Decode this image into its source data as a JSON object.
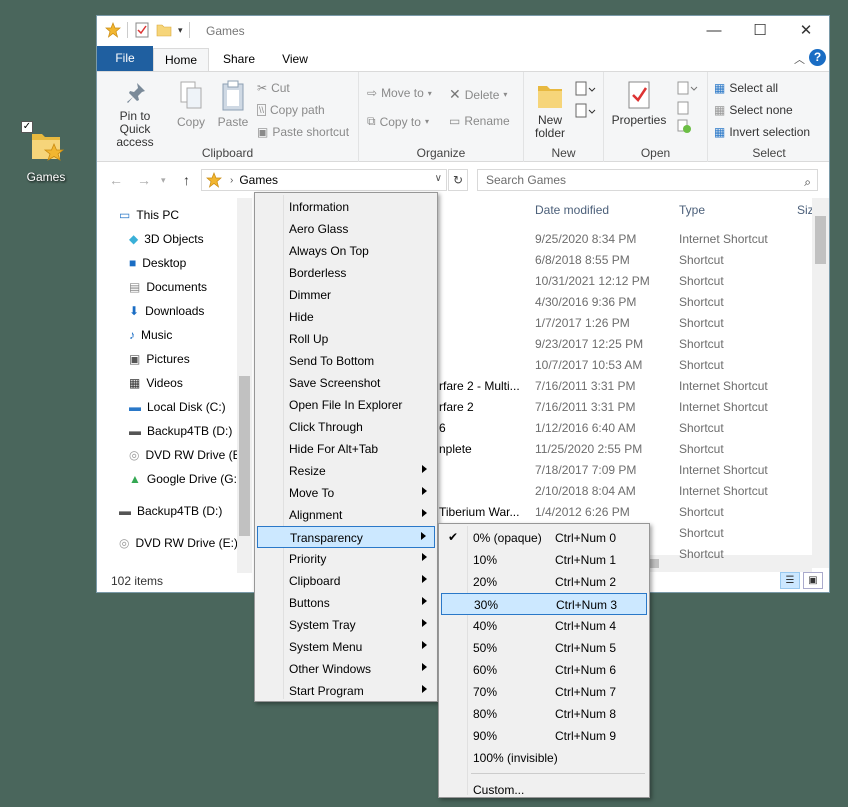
{
  "desktop": {
    "icon_label": "Games"
  },
  "window": {
    "title": "Games",
    "tabs": [
      "File",
      "Home",
      "Share",
      "View"
    ],
    "ribbon": {
      "clipboard": {
        "pin_label": "Pin to Quick\naccess",
        "copy_label": "Copy",
        "paste_label": "Paste",
        "cut_label": "Cut",
        "copy_path_label": "Copy path",
        "paste_shortcut_label": "Paste shortcut",
        "group_label": "Clipboard"
      },
      "organize": {
        "move_to_label": "Move to",
        "copy_to_label": "Copy to",
        "delete_label": "Delete",
        "rename_label": "Rename",
        "group_label": "Organize"
      },
      "new": {
        "new_folder_label": "New\nfolder",
        "group_label": "New"
      },
      "open": {
        "properties_label": "Properties",
        "group_label": "Open"
      },
      "select": {
        "select_all_label": "Select all",
        "select_none_label": "Select none",
        "invert_label": "Invert selection",
        "group_label": "Select"
      }
    },
    "address": {
      "path": "Games",
      "search_placeholder": "Search Games"
    },
    "nav": [
      "This PC",
      "3D Objects",
      "Desktop",
      "Documents",
      "Downloads",
      "Music",
      "Pictures",
      "Videos",
      "Local Disk (C:)",
      "Backup4TB (D:)",
      "DVD RW Drive (E",
      "Google Drive (G:",
      "Backup4TB (D:)",
      "DVD RW Drive (E:)"
    ],
    "columns": {
      "date": "Date modified",
      "type": "Type",
      "size": "Siz"
    },
    "rows": [
      {
        "name": "",
        "date": "9/25/2020 8:34 PM",
        "type": "Internet Shortcut"
      },
      {
        "name": "",
        "date": "6/8/2018 8:55 PM",
        "type": "Shortcut"
      },
      {
        "name": "",
        "date": "10/31/2021 12:12 PM",
        "type": "Shortcut"
      },
      {
        "name": "",
        "date": "4/30/2016 9:36 PM",
        "type": "Shortcut"
      },
      {
        "name": "",
        "date": "1/7/2017 1:26 PM",
        "type": "Shortcut"
      },
      {
        "name": "",
        "date": "9/23/2017 12:25 PM",
        "type": "Shortcut"
      },
      {
        "name": "",
        "date": "10/7/2017 10:53 AM",
        "type": "Shortcut"
      },
      {
        "name": "rfare 2 - Multi...",
        "date": "7/16/2011 3:31 PM",
        "type": "Internet Shortcut"
      },
      {
        "name": "rfare 2",
        "date": "7/16/2011 3:31 PM",
        "type": "Internet Shortcut"
      },
      {
        "name": "6",
        "date": "1/12/2016 6:40 AM",
        "type": "Shortcut"
      },
      {
        "name": "nplete",
        "date": "11/25/2020 2:55 PM",
        "type": "Shortcut"
      },
      {
        "name": "",
        "date": "7/18/2017 7:09 PM",
        "type": "Internet Shortcut"
      },
      {
        "name": "",
        "date": "2/10/2018 8:04 AM",
        "type": "Internet Shortcut"
      },
      {
        "name": "Tiberium War...",
        "date": "1/4/2012 6:26 PM",
        "type": "Shortcut"
      },
      {
        "name": "",
        "date": "",
        "type": "Shortcut"
      },
      {
        "name": "",
        "date": "",
        "type": "Shortcut"
      }
    ],
    "status": {
      "count": "102 items"
    }
  },
  "context_menu": {
    "items": [
      {
        "label": "Information",
        "sub": false
      },
      {
        "label": "Aero Glass",
        "sub": false
      },
      {
        "label": "Always On Top",
        "sub": false
      },
      {
        "label": "Borderless",
        "sub": false
      },
      {
        "label": "Dimmer",
        "sub": false
      },
      {
        "label": "Hide",
        "sub": false
      },
      {
        "label": "Roll Up",
        "sub": false
      },
      {
        "label": "Send To Bottom",
        "sub": false
      },
      {
        "label": "Save Screenshot",
        "sub": false
      },
      {
        "label": "Open File In Explorer",
        "sub": false
      },
      {
        "label": "Click Through",
        "sub": false
      },
      {
        "label": "Hide For Alt+Tab",
        "sub": false
      },
      {
        "label": "Resize",
        "sub": true
      },
      {
        "label": "Move To",
        "sub": true
      },
      {
        "label": "Alignment",
        "sub": true
      },
      {
        "label": "Transparency",
        "sub": true,
        "highlighted": true
      },
      {
        "label": "Priority",
        "sub": true
      },
      {
        "label": "Clipboard",
        "sub": true
      },
      {
        "label": "Buttons",
        "sub": true
      },
      {
        "label": "System Tray",
        "sub": true
      },
      {
        "label": "System Menu",
        "sub": true
      },
      {
        "label": "Other Windows",
        "sub": true
      },
      {
        "label": "Start Program",
        "sub": true
      }
    ]
  },
  "transparency_menu": {
    "items": [
      {
        "label": "0% (opaque)",
        "shortcut": "Ctrl+Num 0",
        "checked": true
      },
      {
        "label": "10%",
        "shortcut": "Ctrl+Num 1"
      },
      {
        "label": "20%",
        "shortcut": "Ctrl+Num 2"
      },
      {
        "label": "30%",
        "shortcut": "Ctrl+Num 3",
        "highlighted": true
      },
      {
        "label": "40%",
        "shortcut": "Ctrl+Num 4"
      },
      {
        "label": "50%",
        "shortcut": "Ctrl+Num 5"
      },
      {
        "label": "60%",
        "shortcut": "Ctrl+Num 6"
      },
      {
        "label": "70%",
        "shortcut": "Ctrl+Num 7"
      },
      {
        "label": "80%",
        "shortcut": "Ctrl+Num 8"
      },
      {
        "label": "90%",
        "shortcut": "Ctrl+Num 9"
      },
      {
        "label": "100% (invisible)",
        "shortcut": ""
      }
    ],
    "custom_label": "Custom..."
  },
  "colors": {
    "desktop_bg": "#4a665c",
    "file_tab": "#1f5fa0",
    "menu_highlight": "#cce8ff",
    "menu_highlight_border": "#2a78c8"
  }
}
